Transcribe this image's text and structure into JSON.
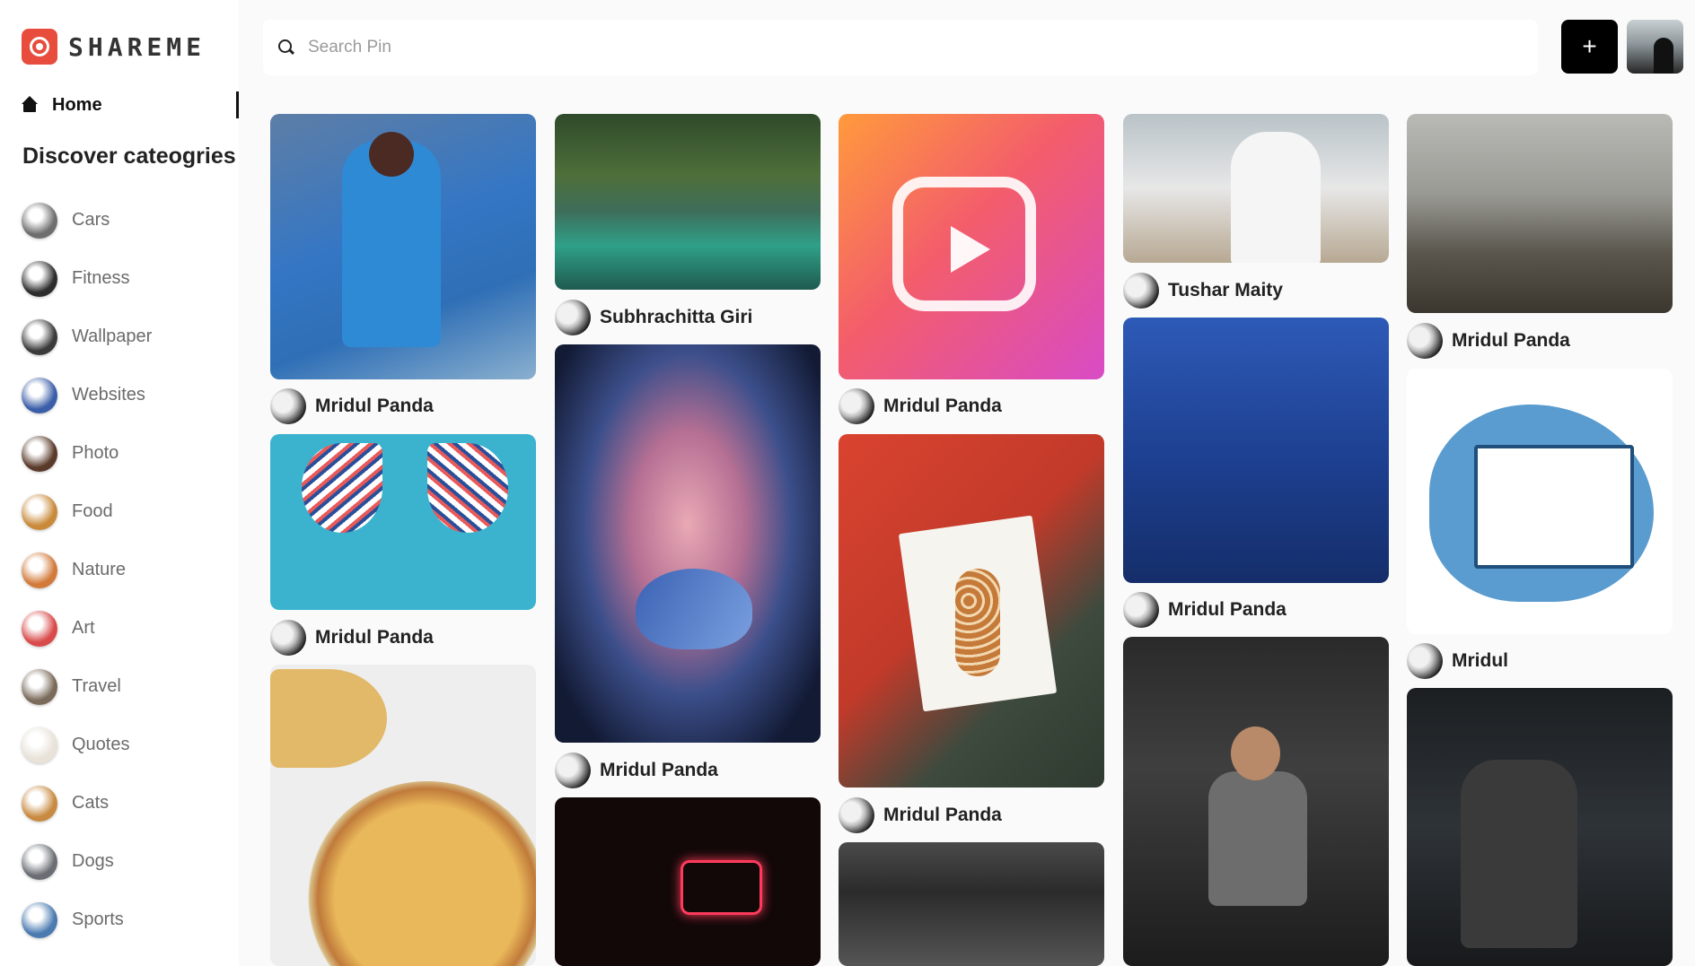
{
  "brand": {
    "name": "SHAREME"
  },
  "nav": {
    "home_label": "Home"
  },
  "sidebar": {
    "discover_heading": "Discover cateogries",
    "categories": [
      {
        "label": "Cars",
        "color": "#6e6e6e"
      },
      {
        "label": "Fitness",
        "color": "#2c2c2c"
      },
      {
        "label": "Wallpaper",
        "color": "#3a3a3a"
      },
      {
        "label": "Websites",
        "color": "#3b5ea8"
      },
      {
        "label": "Photo",
        "color": "#5a3a2a"
      },
      {
        "label": "Food",
        "color": "#c98a3a"
      },
      {
        "label": "Nature",
        "color": "#d27a3a"
      },
      {
        "label": "Art",
        "color": "#d94a4a"
      },
      {
        "label": "Travel",
        "color": "#7a6a5a"
      },
      {
        "label": "Quotes",
        "color": "#e8e2d8"
      },
      {
        "label": "Cats",
        "color": "#c88a40"
      },
      {
        "label": "Dogs",
        "color": "#6a6e74"
      },
      {
        "label": "Sports",
        "color": "#4a7ab0"
      }
    ]
  },
  "search": {
    "placeholder": "Search Pin",
    "value": ""
  },
  "header": {
    "add_label": "+"
  },
  "pins": [
    {
      "user": "Mridul Panda",
      "image": "cricket-player"
    },
    {
      "user": "Mridul Panda",
      "image": "wings-bicycle"
    },
    {
      "user": "",
      "image": "pizza"
    },
    {
      "user": "Subhrachitta Giri",
      "image": "river"
    },
    {
      "user": "Mridul Panda",
      "image": "face-art-butterfly"
    },
    {
      "user": "",
      "image": "neon-like"
    },
    {
      "user": "Mridul Panda",
      "image": "instagram-reels"
    },
    {
      "user": "Mridul Panda",
      "image": "giraffe-painting"
    },
    {
      "user": "",
      "image": "gym"
    },
    {
      "user": "Tushar Maity",
      "image": "cricket-batsman"
    },
    {
      "user": "Mridul Panda",
      "image": "pokemon-go-holidays"
    },
    {
      "user": "",
      "image": "dumbbell-workout"
    },
    {
      "user": "Mridul Panda",
      "image": "beach"
    },
    {
      "user": "Mridul",
      "image": "website-illustration"
    },
    {
      "user": "",
      "image": "fitness-back"
    }
  ]
}
